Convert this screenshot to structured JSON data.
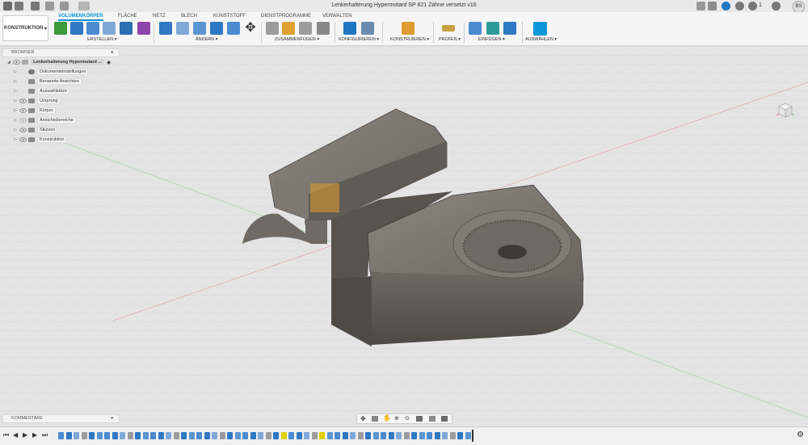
{
  "window": {
    "title": "Lenkerhalterung Hypermotard SP 821 Zähne versetzt v16",
    "user_initials": "BS",
    "notification_count": "1"
  },
  "workspace": {
    "label": "KONSTRUKTION"
  },
  "tabs": [
    "VOLUMENKÖRPER",
    "FLÄCHE",
    "NETZ",
    "BLECH",
    "KUNSTSTOFF",
    "DIENSTPROGRAMME",
    "VERWALTEN"
  ],
  "groups": {
    "create": "ERSTELLEN ▾",
    "modify": "ÄNDERN ▾",
    "assemble": "ZUSAMMENFÜGEN ▾",
    "configure": "KONFIGURIEREN ▾",
    "construct": "KONSTRUIEREN ▾",
    "inspect": "PRÜFEN ▾",
    "insert": "EINFÜGEN ▾",
    "select": "AUSWÄHLEN ▾"
  },
  "browser": {
    "title": "BROWSER",
    "root": "Lenkerhalterung Hypermotard ...",
    "items": [
      "Dokumenteinstellungen",
      "Benannte Ansichten",
      "Auswahlsätze",
      "Ursprung",
      "Körper",
      "Ansichtsbereiche",
      "Skizzen",
      "Konstruktion"
    ]
  },
  "comments": {
    "label": "KOMMENTARE"
  },
  "colors": {
    "accent": "#0696d7",
    "part": "#6e6a63"
  }
}
